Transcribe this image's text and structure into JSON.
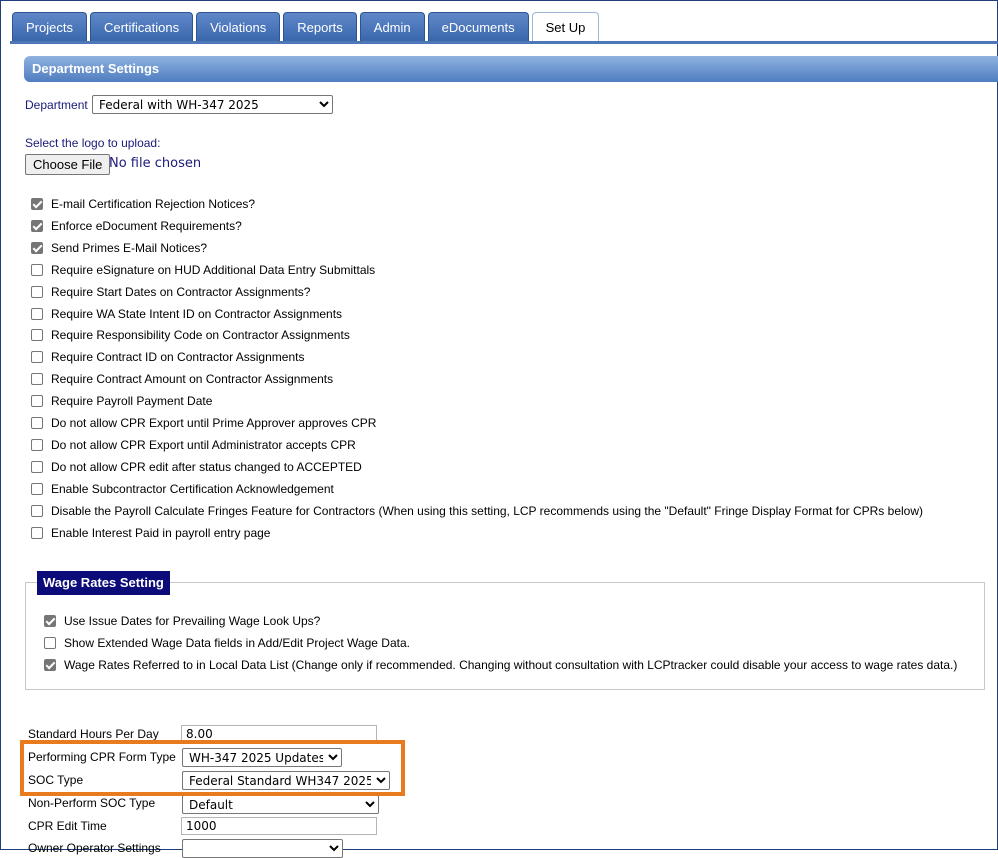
{
  "tabs": [
    "Projects",
    "Certifications",
    "Violations",
    "Reports",
    "Admin",
    "eDocuments",
    "Set Up"
  ],
  "active_tab": "Set Up",
  "section_title": "Department Settings",
  "department": {
    "label": "Department",
    "selected": "Federal with WH-347 2025"
  },
  "logo": {
    "label": "Select the logo to upload:",
    "button": "Choose File",
    "status": "No file chosen"
  },
  "settings": [
    {
      "label": "E-mail Certification Rejection Notices?",
      "checked": true
    },
    {
      "label": "Enforce eDocument Requirements?",
      "checked": true
    },
    {
      "label": "Send Primes E-Mail Notices?",
      "checked": true
    },
    {
      "label": "Require eSignature on HUD Additional Data Entry Submittals",
      "checked": false
    },
    {
      "label": "Require Start Dates on Contractor Assignments?",
      "checked": false
    },
    {
      "label": "Require WA State Intent ID on Contractor Assignments",
      "checked": false
    },
    {
      "label": "Require Responsibility Code on Contractor Assignments",
      "checked": false
    },
    {
      "label": "Require Contract ID on Contractor Assignments",
      "checked": false
    },
    {
      "label": "Require Contract Amount on Contractor Assignments",
      "checked": false
    },
    {
      "label": "Require Payroll Payment Date",
      "checked": false
    },
    {
      "label": "Do not allow CPR Export until Prime Approver approves CPR",
      "checked": false
    },
    {
      "label": "Do not allow CPR Export until Administrator accepts CPR",
      "checked": false
    },
    {
      "label": "Do not allow CPR edit after status changed to ACCEPTED",
      "checked": false
    },
    {
      "label": "Enable Subcontractor Certification Acknowledgement",
      "checked": false
    },
    {
      "label": "Disable the Payroll Calculate Fringes Feature for Contractors (When using this setting, LCP recommends using the \"Default\" Fringe Display Format for CPRs below)",
      "checked": false
    },
    {
      "label": "Enable Interest Paid in payroll entry page",
      "checked": false
    }
  ],
  "wage_rates": {
    "title": "Wage Rates Setting",
    "items": [
      {
        "label": "Use Issue Dates for Prevailing Wage Look Ups?",
        "checked": true
      },
      {
        "label": "Show Extended Wage Data fields in Add/Edit Project Wage Data.",
        "checked": false
      },
      {
        "label": "Wage Rates Referred to in Local Data List (Change only if recommended. Changing without consultation with LCPtracker could disable your access to wage rates data.)",
        "checked": true
      }
    ]
  },
  "fields": {
    "standard_hours": {
      "label": "Standard Hours Per Day",
      "value": "8.00"
    },
    "performing_cpr": {
      "label": "Performing CPR Form Type",
      "value": "WH-347 2025 Updates"
    },
    "soc_type": {
      "label": "SOC Type",
      "value": "Federal Standard WH347 2025"
    },
    "non_perform_soc": {
      "label": "Non-Perform SOC Type",
      "value": "Default"
    },
    "cpr_edit_time": {
      "label": "CPR Edit Time",
      "value": "1000"
    },
    "owner_operator": {
      "label": "Owner Operator Settings",
      "value": ""
    }
  },
  "colors": {
    "tab": "#3a67ad",
    "header": "#4f7dc0",
    "wage_title": "#0b0b7a",
    "highlight": "#e87b1e"
  }
}
